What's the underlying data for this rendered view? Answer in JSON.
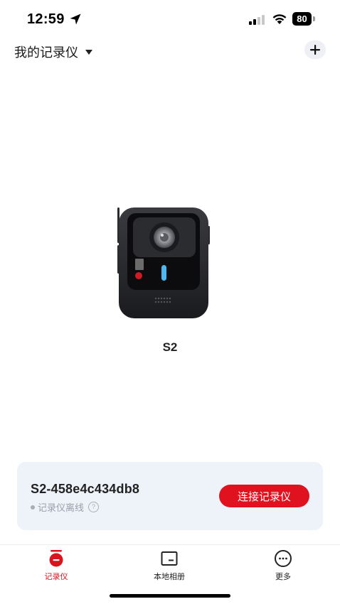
{
  "status_bar": {
    "time": "12:59",
    "battery": "80"
  },
  "header": {
    "title": "我的记录仪",
    "add_label": "+"
  },
  "device": {
    "model_name": "S2"
  },
  "device_card": {
    "device_id": "S2-458e4c434db8",
    "status_text": "记录仪离线",
    "help_label": "?",
    "connect_label": "连接记录仪"
  },
  "tab_bar": {
    "items": [
      {
        "label": "记录仪",
        "icon": "recorder-icon",
        "active": true
      },
      {
        "label": "本地相册",
        "icon": "album-icon",
        "active": false
      },
      {
        "label": "更多",
        "icon": "more-icon",
        "active": false
      }
    ]
  },
  "colors": {
    "accent": "#e1121f",
    "card_background": "#eef2f9",
    "offline_gray": "#a8acb4"
  }
}
